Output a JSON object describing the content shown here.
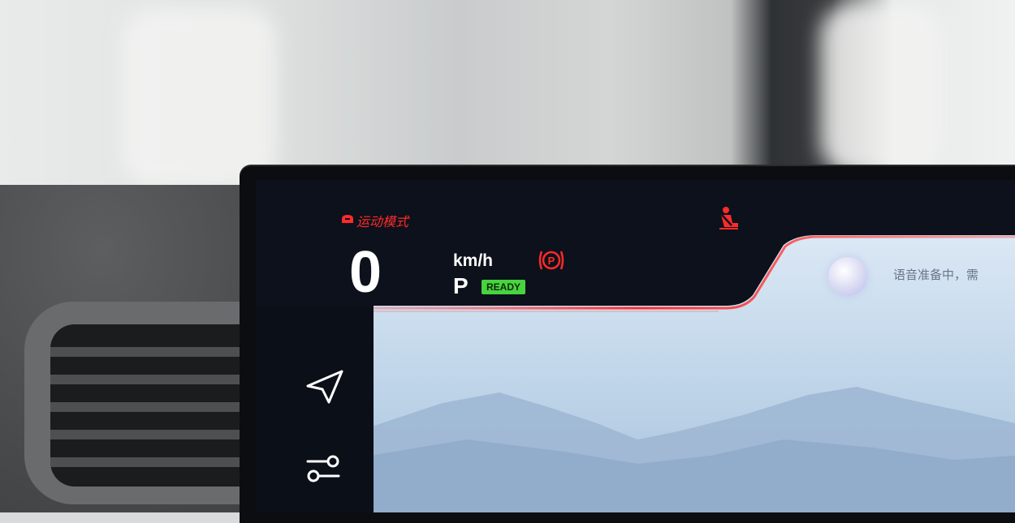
{
  "cluster": {
    "drive_mode_label": "运动模式",
    "speed_value": "0",
    "speed_unit": "km/h",
    "gear": "P",
    "ready_badge": "READY"
  },
  "voice_assistant": {
    "prompt_text": "语音准备中，需"
  },
  "icons": {
    "drive_mode": "drive-mode-icon",
    "parking_brake": "parking-brake-icon",
    "seatbelt_warning": "seatbelt-warning-icon",
    "voice_assistant": "voice-assistant-avatar",
    "navigation": "navigation-arrow-icon",
    "settings": "settings-sliders-icon"
  },
  "colors": {
    "warning_red": "#ff2a2a",
    "ready_green": "#48d33f",
    "screen_dark": "#0a0e17",
    "text_white": "#ffffff"
  }
}
